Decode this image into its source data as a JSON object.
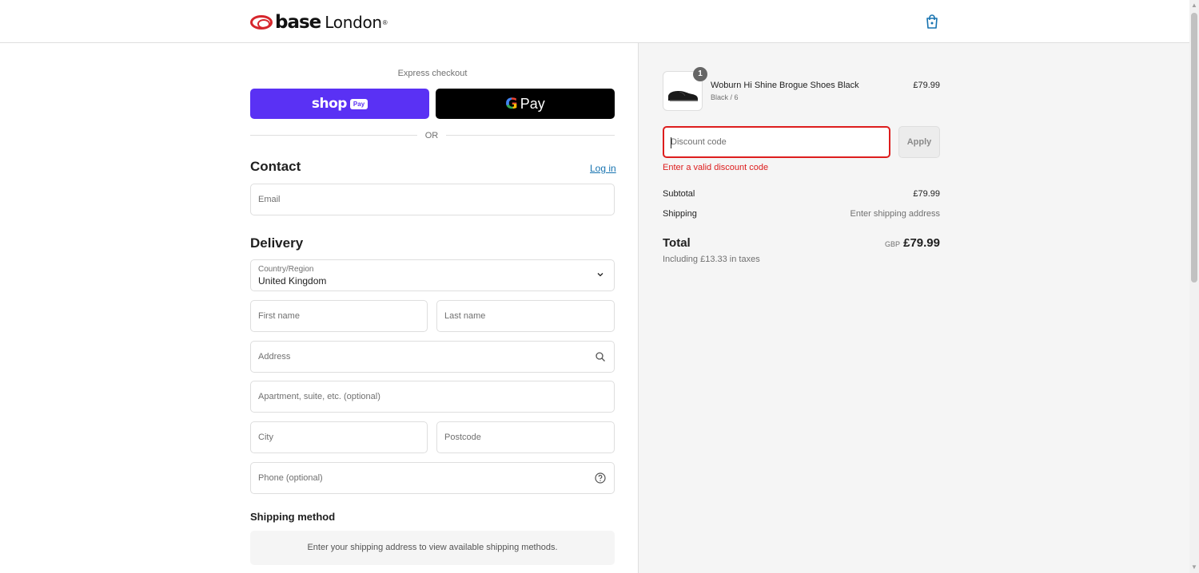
{
  "header": {
    "logo_word1": "base",
    "logo_word2": "London",
    "logo_reg": "®",
    "cart_icon": "shopping-bag-icon"
  },
  "express": {
    "label": "Express checkout",
    "shop_pay": {
      "word": "shop",
      "badge": "Pay"
    },
    "google_pay": {
      "g": "G",
      "word": "Pay"
    },
    "or_text": "OR"
  },
  "contact": {
    "heading": "Contact",
    "login_link": "Log in",
    "email_placeholder": "Email"
  },
  "delivery": {
    "heading": "Delivery",
    "country_label": "Country/Region",
    "country_value": "United Kingdom",
    "first_name_placeholder": "First name",
    "last_name_placeholder": "Last name",
    "address_placeholder": "Address",
    "apartment_placeholder": "Apartment, suite, etc. (optional)",
    "city_placeholder": "City",
    "postcode_placeholder": "Postcode",
    "phone_placeholder": "Phone (optional)"
  },
  "shipping_method": {
    "heading": "Shipping method",
    "message": "Enter your shipping address to view available shipping methods."
  },
  "order_summary": {
    "product": {
      "quantity": "1",
      "name": "Woburn Hi Shine Brogue Shoes Black",
      "variant": "Black / 6",
      "price": "£79.99"
    },
    "discount": {
      "placeholder": "Discount code",
      "apply_label": "Apply",
      "error": "Enter a valid discount code"
    },
    "subtotal_label": "Subtotal",
    "subtotal_value": "£79.99",
    "shipping_label": "Shipping",
    "shipping_value": "Enter shipping address",
    "total_label": "Total",
    "total_currency": "GBP",
    "total_value": "£79.99",
    "taxes_note": "Including £13.33 in taxes"
  },
  "colors": {
    "brand_red": "#d6262c",
    "shop_pay_purple": "#5a31f4",
    "link_blue": "#1773b0",
    "error_red": "#dd1d1d"
  }
}
